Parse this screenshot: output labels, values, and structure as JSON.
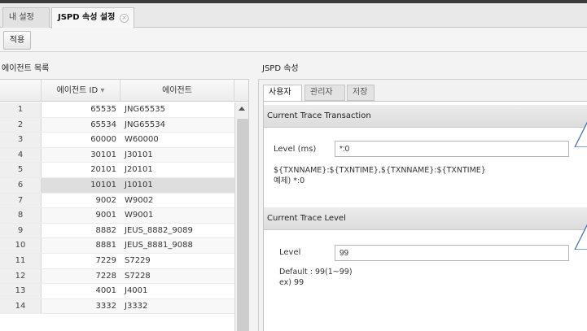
{
  "tabs": [
    {
      "label": "내 설정"
    },
    {
      "label": "JSPD 속성 설정",
      "close": "×"
    }
  ],
  "toolbar": {
    "apply_label": "적용"
  },
  "agent_list": {
    "title": "에이전트 목록",
    "columns": {
      "id": "에이전트 ID",
      "sort_indicator": "▾",
      "name": "에이전트"
    },
    "rows": [
      {
        "no": "1",
        "id": "65535",
        "name": "JNG65535"
      },
      {
        "no": "2",
        "id": "65534",
        "name": "JNG65534"
      },
      {
        "no": "3",
        "id": "60000",
        "name": "W60000"
      },
      {
        "no": "4",
        "id": "30101",
        "name": "J30101"
      },
      {
        "no": "5",
        "id": "20101",
        "name": "J20101"
      },
      {
        "no": "6",
        "id": "10101",
        "name": "J10101"
      },
      {
        "no": "7",
        "id": "9002",
        "name": "W9002"
      },
      {
        "no": "8",
        "id": "9001",
        "name": "W9001"
      },
      {
        "no": "9",
        "id": "8882",
        "name": "JEUS_8882_9089"
      },
      {
        "no": "10",
        "id": "8881",
        "name": "JEUS_8881_9088"
      },
      {
        "no": "11",
        "id": "7229",
        "name": "S7229"
      },
      {
        "no": "12",
        "id": "7228",
        "name": "S7228"
      },
      {
        "no": "13",
        "id": "4001",
        "name": "J4001"
      },
      {
        "no": "14",
        "id": "3332",
        "name": "J3332"
      }
    ],
    "selected_row": 6
  },
  "jspd": {
    "title": "JSPD 속성",
    "subtabs": [
      {
        "label": "사용자"
      },
      {
        "label": "관리자"
      },
      {
        "label": "저장"
      }
    ],
    "current_trace_transaction": {
      "header": "Current Trace Transaction",
      "label": "Level (ms)",
      "value": "*:0",
      "hint1": "${TXNNAME}:${TXNTIME},${TXNNAME}:${TXNTIME}",
      "hint2": "예제) *:0"
    },
    "current_trace_level": {
      "header": "Current Trace Level",
      "label": "Level",
      "value": "99",
      "hint1": "Default : 99(1~99)",
      "hint2": "ex) 99"
    }
  },
  "colors": {
    "accent_blue": "#3a68b8",
    "selected_row": "#dedede"
  },
  "icons": {
    "close": "close-icon",
    "scroll_up": "scroll-up-icon",
    "sort": "sort-desc-icon"
  }
}
